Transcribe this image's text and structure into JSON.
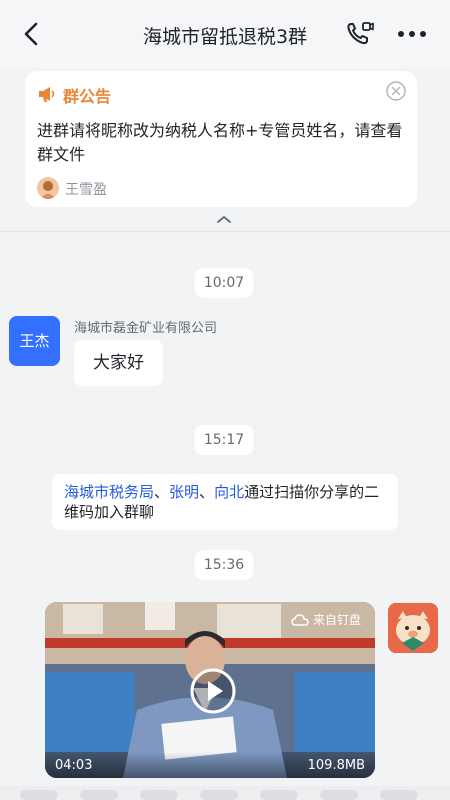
{
  "header": {
    "title": "海城市留抵退税3群",
    "back_icon": "chevron-left-icon",
    "call_icon": "phone-video-icon",
    "more_icon": "more-icon"
  },
  "announcement": {
    "label": "群公告",
    "text": "进群请将昵称改为纳税人名称+专管员姓名，请查看群文件",
    "author": "王雪盈",
    "accent_color": "#e8863a"
  },
  "messages": {
    "time1": "10:07",
    "time2": "15:17",
    "time3": "15:36",
    "msg1": {
      "avatar_text": "王杰",
      "sender": "海城市磊金矿业有限公司",
      "text": "大家好"
    },
    "system": {
      "name1": "海城市税务局",
      "sep1": "、",
      "name2": "张明",
      "sep2": "、",
      "name3": "向北",
      "rest": "通过扫描你分享的二维码加入群聊"
    },
    "video": {
      "source": "来自钉盘",
      "duration": "04:03",
      "size": "109.8MB"
    }
  },
  "colors": {
    "link": "#245bdb",
    "avatar_blue": "#3370ff",
    "background": "#f2f3f5"
  }
}
